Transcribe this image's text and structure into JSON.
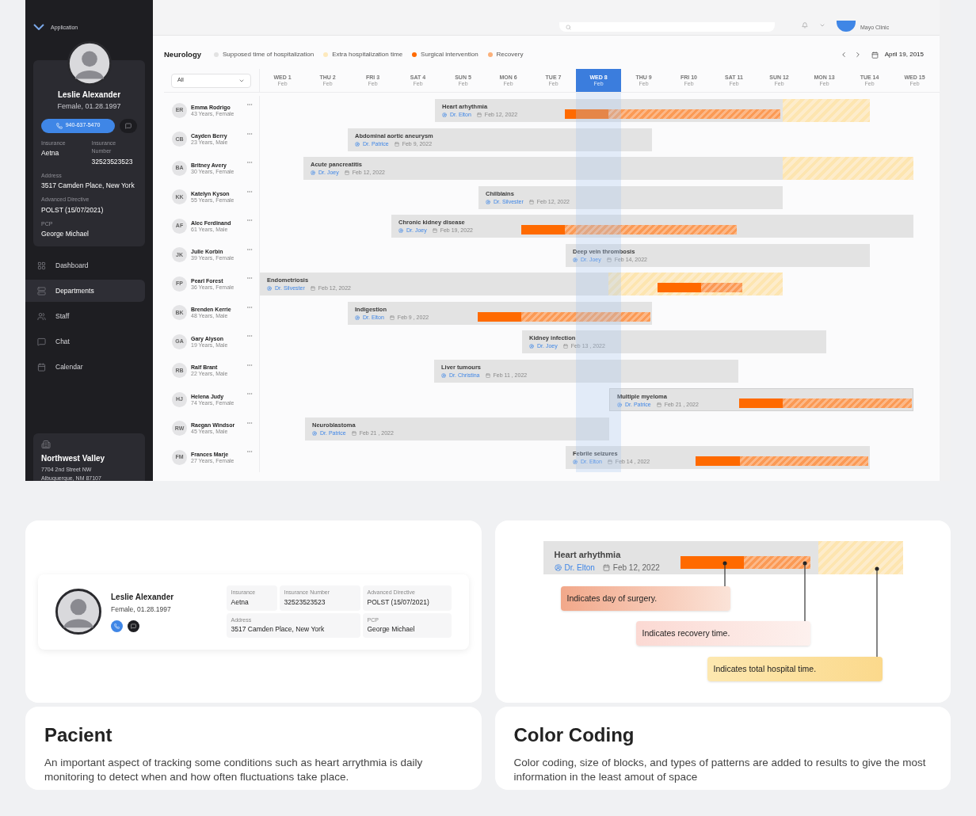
{
  "app": {
    "sidebar": {
      "app_label": "Application",
      "profile": {
        "name": "Leslie Alexander",
        "info": "Female, 01.28.1997",
        "phone": "940-637-5470",
        "fields": [
          {
            "label": "Insurance",
            "value": "Aetna"
          },
          {
            "label": "Insurance Number",
            "value": "32523523523"
          },
          {
            "label": "Address",
            "value": "3517 Camden Place, New York"
          },
          {
            "label": "Advanced Directive",
            "value": "POLST (15/07/2021)"
          },
          {
            "label": "PCP",
            "value": "George Michael"
          }
        ]
      },
      "nav": [
        {
          "label": "Dashboard",
          "selected": false
        },
        {
          "label": "Departments",
          "selected": true
        },
        {
          "label": "Staff",
          "selected": false
        },
        {
          "label": "Chat",
          "selected": false
        },
        {
          "label": "Calendar",
          "selected": false
        }
      ],
      "location": {
        "name": "Northwest Valley",
        "lines": [
          "7704 2nd Street NW",
          "Albuquerque, NM 87107"
        ]
      }
    },
    "header": {
      "clinic": "Mayo Clinic"
    },
    "schedule": {
      "department": "Neurology",
      "legend": [
        {
          "label": "Supposed time of hospitalization",
          "color": "#e2e2e2"
        },
        {
          "label": "Extra hospitalization time",
          "color": "#fde9bd"
        },
        {
          "label": "Surgical intervention",
          "color": "#ff6a00"
        },
        {
          "label": "Recovery",
          "color": "#fbb07a"
        }
      ],
      "date": "April 19, 2015",
      "filter": "All",
      "days": [
        {
          "day": "WED 1",
          "month": "Feb",
          "selected": false
        },
        {
          "day": "THU 2",
          "month": "Feb",
          "selected": false
        },
        {
          "day": "FRI 3",
          "month": "Feb",
          "selected": false
        },
        {
          "day": "SAT 4",
          "month": "Feb",
          "selected": false
        },
        {
          "day": "SUN 5",
          "month": "Feb",
          "selected": false
        },
        {
          "day": "MON 6",
          "month": "Feb",
          "selected": false
        },
        {
          "day": "TUE 7",
          "month": "Feb",
          "selected": false
        },
        {
          "day": "WED 8",
          "month": "Feb",
          "selected": true
        },
        {
          "day": "THU 9",
          "month": "Feb",
          "selected": false
        },
        {
          "day": "FRI 10",
          "month": "Feb",
          "selected": false
        },
        {
          "day": "SAT 11",
          "month": "Feb",
          "selected": false
        },
        {
          "day": "SUN 12",
          "month": "Feb",
          "selected": false
        },
        {
          "day": "MON 13",
          "month": "Feb",
          "selected": false
        },
        {
          "day": "TUE 14",
          "month": "Feb",
          "selected": false
        },
        {
          "day": "WED 15",
          "month": "Feb",
          "selected": false
        }
      ],
      "rows": [
        {
          "initials": "ER",
          "name": "Emma Rodrigo",
          "info": "43 Years, Female",
          "diagnosis": "Heart arhythmia",
          "doctor": "Dr. Elton",
          "date": "Feb 12, 2022"
        },
        {
          "initials": "CB",
          "name": "Cayden Berry",
          "info": "23 Years, Male",
          "diagnosis": "Abdominal aortic aneurysm",
          "doctor": "Dr. Patrice",
          "date": "Feb 9, 2022"
        },
        {
          "initials": "BA",
          "name": "Britney Avery",
          "info": "30 Years, Female",
          "diagnosis": "Acute pancreatitis",
          "doctor": "Dr. Joey",
          "date": "Feb 12, 2022"
        },
        {
          "initials": "KK",
          "name": "Katelyn Kyson",
          "info": "55 Years, Female",
          "diagnosis": "Chilblains",
          "doctor": "Dr. Silvester",
          "date": "Feb 12, 2022"
        },
        {
          "initials": "AF",
          "name": "Alec Ferdinand",
          "info": "61 Years, Male",
          "diagnosis": "Chronic kidney disease",
          "doctor": "Dr. Joey",
          "date": "Feb 19, 2022"
        },
        {
          "initials": "JK",
          "name": "Julie Korbin",
          "info": "39 Years, Female",
          "diagnosis": "Deep vein thrombosis",
          "doctor": "Dr. Joey",
          "date": "Feb 14, 2022"
        },
        {
          "initials": "FP",
          "name": "Pearl Forest",
          "info": "36 Years, Female",
          "diagnosis": "Endometriosis",
          "doctor": "Dr. Silvester",
          "date": "Feb 12, 2022"
        },
        {
          "initials": "BK",
          "name": "Brenden Kerrie",
          "info": "48 Years, Male",
          "diagnosis": "Indigestion",
          "doctor": "Dr. Elton",
          "date": "Feb 9 , 2022"
        },
        {
          "initials": "GA",
          "name": "Gary Alyson",
          "info": "19 Years, Male",
          "diagnosis": "Kidney infection",
          "doctor": "Dr. Joey",
          "date": "Feb 13 , 2022"
        },
        {
          "initials": "RB",
          "name": "Ralf Brant",
          "info": "22 Years, Male",
          "diagnosis": "Liver tumours",
          "doctor": "Dr. Christina",
          "date": "Feb 11 , 2022"
        },
        {
          "initials": "HJ",
          "name": "Helena Judy",
          "info": "74 Years, Female",
          "diagnosis": "Multiple myeloma",
          "doctor": "Dr. Patrice",
          "date": "Feb 21 , 2022"
        },
        {
          "initials": "RW",
          "name": "Raegan Windsor",
          "info": "45 Years, Male",
          "diagnosis": "Neuroblastoma",
          "doctor": "Dr. Patrice",
          "date": "Feb 21 , 2022"
        },
        {
          "initials": "FM",
          "name": "Frances Marje",
          "info": "27 Years, Female",
          "diagnosis": "Febrile seizures",
          "doctor": "Dr. Elton",
          "date": "Feb 14 , 2022"
        }
      ]
    }
  },
  "patient_card": {
    "name": "Leslie Alexander",
    "info": "Female, 01.28.1997",
    "fields": [
      {
        "label": "Insurance",
        "value": "Aetna"
      },
      {
        "label": "Insurance Number",
        "value": "32523523523"
      },
      {
        "label": "Advanced Directive",
        "value": "POLST (15/07/2021)"
      },
      {
        "label": "Address",
        "value": "3517 Camden Place, New York"
      },
      {
        "label": "PCP",
        "value": "George Michael"
      }
    ]
  },
  "color_coding": {
    "example": {
      "diagnosis": "Heart arhythmia",
      "doctor": "Dr. Elton",
      "date": "Feb 12, 2022"
    },
    "callouts": [
      {
        "kind": "surgery",
        "text": "Indicates day of surgery."
      },
      {
        "kind": "recovery",
        "text": "Indicates recovery time."
      },
      {
        "kind": "total",
        "text": "Indicates total hospital time."
      }
    ]
  },
  "captions": [
    {
      "title": "Pacient",
      "text": "An important aspect of tracking some conditions such as heart arrythmia is daily monitoring to detect when and how often fluctuations take place."
    },
    {
      "title": "Color Coding",
      "text": "Color coding, size of blocks, and types of patterns are added to results to give the most information in the least amout of space"
    }
  ]
}
